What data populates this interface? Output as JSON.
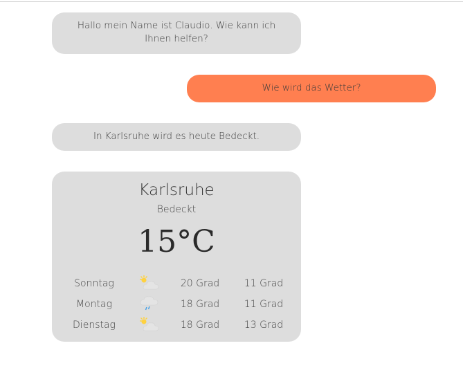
{
  "chat": {
    "messages": [
      {
        "sender": "bot",
        "text": "Hallo mein Name ist Claudio. Wie kann ich Ihnen helfen?"
      },
      {
        "sender": "user",
        "text": "Wie wird das Wetter?"
      },
      {
        "sender": "bot",
        "text": "In Karlsruhe wird es heute Bedeckt."
      }
    ]
  },
  "weather": {
    "city": "Karlsruhe",
    "condition": "Bedeckt",
    "temperature": "15°C",
    "forecast": [
      {
        "day": "Sonntag",
        "icon": "sun-cloud-icon",
        "high": "20 Grad",
        "low": "11 Grad"
      },
      {
        "day": "Montag",
        "icon": "rain-cloud-icon",
        "high": "18 Grad",
        "low": "11 Grad"
      },
      {
        "day": "Dienstag",
        "icon": "sun-cloud-icon",
        "high": "18 Grad",
        "low": "13 Grad"
      }
    ]
  },
  "colors": {
    "bot_bubble": "#dddddd",
    "user_bubble": "#ff7f50",
    "card": "#dddddd"
  }
}
